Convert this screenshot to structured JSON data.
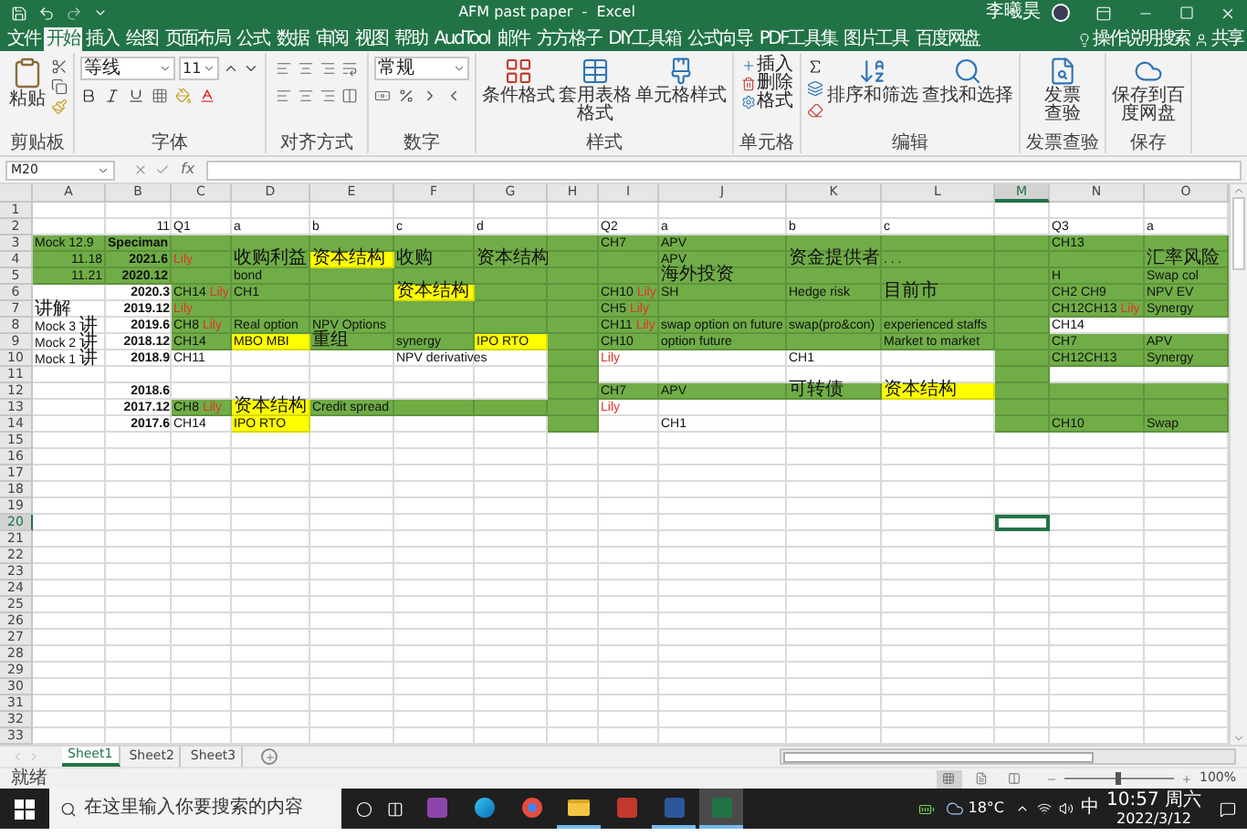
{
  "window": {
    "title": "AFM past paper  -  Excel",
    "user": "李曦昊"
  },
  "tabs": [
    {
      "label": "文件",
      "selected": false
    },
    {
      "label": "开始",
      "selected": true
    },
    {
      "label": "插入",
      "selected": false
    },
    {
      "label": "绘图",
      "selected": false
    },
    {
      "label": "页面布局",
      "selected": false
    },
    {
      "label": "公式",
      "selected": false
    },
    {
      "label": "数据",
      "selected": false
    },
    {
      "label": "审阅",
      "selected": false
    },
    {
      "label": "视图",
      "selected": false
    },
    {
      "label": "帮助",
      "selected": false
    },
    {
      "label": "AudTool",
      "selected": false
    },
    {
      "label": "邮件",
      "selected": false
    },
    {
      "label": "方方格子",
      "selected": false
    },
    {
      "label": "DIY工具箱",
      "selected": false
    },
    {
      "label": "公式向导",
      "selected": false
    },
    {
      "label": "PDF工具集",
      "selected": false
    },
    {
      "label": "图片工具",
      "selected": false
    },
    {
      "label": "百度网盘",
      "selected": false
    }
  ],
  "tell_me": "操作说明搜索",
  "share": "共享",
  "ribbon": [
    {
      "kind": "clipboard",
      "label": "剪贴板",
      "button": "粘贴"
    },
    {
      "kind": "font",
      "label": "字体",
      "font_name": "等线",
      "font_size": "11"
    },
    {
      "kind": "alignment",
      "label": "对齐方式"
    },
    {
      "kind": "number",
      "label": "数字",
      "format": "常规"
    },
    {
      "kind": "styles",
      "label": "样式",
      "buttons": [
        "条件格式",
        "套用表格格式",
        "单元格样式"
      ]
    },
    {
      "kind": "cells",
      "label": "单元格",
      "buttons": [
        "插入",
        "删除",
        "格式"
      ]
    },
    {
      "kind": "editing",
      "label": "编辑",
      "buttons": [
        "排序和筛选",
        "查找和选择"
      ]
    },
    {
      "kind": "invoice",
      "label": "发票查验",
      "button": "发票查验"
    },
    {
      "kind": "save",
      "label": "保存",
      "button": "保存到百度网盘"
    }
  ],
  "formula_bar": {
    "name_box": "M20",
    "fx": "fx"
  },
  "columns": [
    {
      "label": "A",
      "selected": false
    },
    {
      "label": "B",
      "selected": false
    },
    {
      "label": "C",
      "selected": false
    },
    {
      "label": "D",
      "selected": false
    },
    {
      "label": "E",
      "selected": false
    },
    {
      "label": "F",
      "selected": false
    },
    {
      "label": "G",
      "selected": false
    },
    {
      "label": "H",
      "selected": false
    },
    {
      "label": "I",
      "selected": false
    },
    {
      "label": "J",
      "selected": false
    },
    {
      "label": "K",
      "selected": false
    },
    {
      "label": "L",
      "selected": false
    },
    {
      "label": "M",
      "selected": true
    },
    {
      "label": "N",
      "selected": false
    },
    {
      "label": "O",
      "selected": false
    }
  ],
  "rows": [
    {
      "header": "1",
      "selected": false
    },
    {
      "header": "2",
      "selected": false,
      "cells": [
        {},
        {
          "text": "11"
        },
        {
          "text": "Q1"
        },
        {
          "text": "a"
        },
        {
          "text": "b"
        },
        {
          "text": "c"
        },
        {
          "text": "d"
        },
        {},
        {
          "text": "Q2"
        },
        {
          "text": "a"
        },
        {
          "text": "b"
        },
        {
          "text": "c"
        },
        {},
        {
          "text": "Q3"
        },
        {
          "text": "a"
        }
      ]
    },
    {
      "header": "3",
      "selected": false,
      "cells": [
        {
          "color": "#70ad47",
          "text": "Mock 12.9"
        },
        {
          "color": "#70ad47",
          "text": "Speciman",
          "bold": true
        },
        {
          "color": "#70ad47"
        },
        {
          "color": "#70ad47"
        },
        {
          "color": "#70ad47"
        },
        {
          "color": "#70ad47"
        },
        {
          "color": "#70ad47"
        },
        {
          "color": "#70ad47"
        },
        {
          "color": "#70ad47",
          "text": "CH7"
        },
        {
          "color": "#70ad47",
          "text": "APV"
        },
        {
          "color": "#70ad47"
        },
        {
          "color": "#70ad47"
        },
        {
          "color": "#70ad47"
        },
        {
          "color": "#70ad47",
          "text": "CH13"
        },
        {
          "color": "#70ad47"
        }
      ]
    },
    {
      "header": "4",
      "selected": false,
      "cells": [
        {
          "color": "#70ad47",
          "text": "11.18"
        },
        {
          "color": "#70ad47",
          "text": "2021.6",
          "bold": true
        },
        {
          "color": "#70ad47",
          "flag": "Lily"
        },
        {
          "color": "#70ad47",
          "text": "收购利益"
        },
        {
          "color": "#ffff00",
          "text": "资本结构"
        },
        {
          "color": "#70ad47",
          "text": "收购"
        },
        {
          "color": "#70ad47",
          "text": "资本结构"
        },
        {
          "color": "#70ad47"
        },
        {
          "color": "#70ad47"
        },
        {
          "color": "#70ad47",
          "text": "APV"
        },
        {
          "color": "#70ad47",
          "text": "资金提供者"
        },
        {
          "color": "#70ad47",
          "text": ". . ."
        },
        {
          "color": "#70ad47"
        },
        {
          "color": "#70ad47"
        },
        {
          "color": "#70ad47",
          "text": "汇率风险"
        }
      ]
    },
    {
      "header": "5",
      "selected": false,
      "cells": [
        {
          "color": "#70ad47",
          "text": "11.21"
        },
        {
          "color": "#70ad47",
          "text": "2020.12",
          "bold": true
        },
        {
          "color": "#70ad47"
        },
        {
          "color": "#70ad47",
          "text": "bond"
        },
        {
          "color": "#70ad47"
        },
        {
          "color": "#70ad47"
        },
        {
          "color": "#70ad47"
        },
        {
          "color": "#70ad47"
        },
        {
          "color": "#70ad47"
        },
        {
          "color": "#70ad47",
          "text": "海外投资"
        },
        {
          "color": "#70ad47"
        },
        {
          "color": "#70ad47"
        },
        {
          "color": "#70ad47"
        },
        {
          "color": "#70ad47",
          "text": "H"
        },
        {
          "color": "#70ad47",
          "text": "Swap col"
        }
      ]
    },
    {
      "header": "6",
      "selected": false,
      "cells": [
        {},
        {
          "text": "2020.3",
          "bold": true
        },
        {
          "color": "#70ad47",
          "text": "CH14",
          "flag": "Lily"
        },
        {
          "color": "#70ad47",
          "text": "CH1"
        },
        {
          "color": "#70ad47"
        },
        {
          "color": "#ffff00",
          "text": "资本结构"
        },
        {
          "color": "#70ad47"
        },
        {
          "color": "#70ad47"
        },
        {
          "color": "#70ad47",
          "text": "CH10",
          "flag": "Lily"
        },
        {
          "color": "#70ad47",
          "text": "SH"
        },
        {
          "color": "#70ad47",
          "text": "Hedge risk"
        },
        {
          "color": "#70ad47",
          "text": "目前市"
        },
        {
          "color": "#70ad47"
        },
        {
          "color": "#70ad47",
          "text": "CH2 CH9"
        },
        {
          "color": "#70ad47",
          "text": "NPV EV"
        }
      ]
    },
    {
      "header": "7",
      "selected": false,
      "cells": [
        {
          "text": "讲解"
        },
        {
          "text": "2019.12",
          "bold": true
        },
        {
          "color": "#70ad47",
          "flag": "Lily"
        },
        {
          "color": "#70ad47"
        },
        {
          "color": "#70ad47"
        },
        {
          "color": "#70ad47"
        },
        {
          "color": "#70ad47"
        },
        {
          "color": "#70ad47"
        },
        {
          "color": "#70ad47",
          "text": "CH5",
          "flag": "Lily"
        },
        {
          "color": "#70ad47"
        },
        {
          "color": "#70ad47"
        },
        {
          "color": "#70ad47"
        },
        {
          "color": "#70ad47"
        },
        {
          "color": "#70ad47",
          "text": "CH12CH13",
          "flag": "Lily"
        },
        {
          "color": "#70ad47",
          "text": "Synergy"
        }
      ]
    },
    {
      "header": "8",
      "selected": false,
      "cells": [
        {
          "text": "Mock 3 讲"
        },
        {
          "text": "2019.6",
          "bold": true
        },
        {
          "color": "#70ad47",
          "text": "CH8",
          "flag": "Lily"
        },
        {
          "color": "#70ad47",
          "text": "Real option"
        },
        {
          "color": "#70ad47",
          "text": "NPV Options"
        },
        {
          "color": "#70ad47"
        },
        {
          "color": "#70ad47"
        },
        {
          "color": "#70ad47"
        },
        {
          "color": "#70ad47",
          "text": "CH11",
          "flag": "Lily"
        },
        {
          "color": "#70ad47",
          "text": "swap option on future"
        },
        {
          "color": "#70ad47",
          "text": "swap(pro&con)"
        },
        {
          "color": "#70ad47",
          "text": "experienced staffs"
        },
        {
          "color": "#70ad47"
        },
        {
          "text": "CH14"
        },
        {}
      ]
    },
    {
      "header": "9",
      "selected": false,
      "cells": [
        {
          "text": "Mock 2 讲"
        },
        {
          "text": "2018.12",
          "bold": true
        },
        {
          "color": "#70ad47",
          "text": "CH14"
        },
        {
          "color": "#ffff00",
          "text": "MBO MBI"
        },
        {
          "color": "#70ad47",
          "text": "重组"
        },
        {
          "color": "#70ad47",
          "text": "synergy"
        },
        {
          "color": "#ffff00",
          "text": "IPO RTO"
        },
        {
          "color": "#70ad47"
        },
        {
          "color": "#70ad47",
          "text": "CH10"
        },
        {
          "color": "#70ad47",
          "text": "option future"
        },
        {
          "color": "#70ad47"
        },
        {
          "color": "#70ad47",
          "text": "Market to market"
        },
        {
          "color": "#70ad47"
        },
        {
          "color": "#70ad47",
          "text": "CH7"
        },
        {
          "color": "#70ad47",
          "text": "APV"
        }
      ]
    },
    {
      "header": "10",
      "selected": false,
      "cells": [
        {
          "text": "Mock 1 讲"
        },
        {
          "text": "2018.9",
          "bold": true
        },
        {
          "text": "CH11"
        },
        {},
        {},
        {
          "text": "NPV derivatives"
        },
        {},
        {
          "color": "#70ad47"
        },
        {
          "flag": "Lily"
        },
        {},
        {
          "text": "CH1"
        },
        {},
        {
          "color": "#70ad47"
        },
        {
          "color": "#70ad47",
          "text": "CH12CH13"
        },
        {
          "color": "#70ad47",
          "text": "Synergy"
        }
      ]
    },
    {
      "header": "11",
      "selected": false,
      "cells": [
        {},
        {},
        {},
        {},
        {},
        {},
        {},
        {
          "color": "#70ad47"
        },
        {},
        {},
        {},
        {},
        {
          "color": "#70ad47"
        },
        {},
        {}
      ]
    },
    {
      "header": "12",
      "selected": false,
      "cells": [
        {},
        {
          "text": "2018.6",
          "bold": true
        },
        {},
        {},
        {},
        {},
        {},
        {
          "color": "#70ad47"
        },
        {
          "color": "#70ad47",
          "text": "CH7"
        },
        {
          "color": "#70ad47",
          "text": "APV"
        },
        {
          "color": "#70ad47",
          "text": "可转债"
        },
        {
          "color": "#ffff00",
          "text": "资本结构"
        },
        {
          "color": "#70ad47"
        },
        {
          "color": "#70ad47"
        },
        {
          "color": "#70ad47"
        }
      ]
    },
    {
      "header": "13",
      "selected": false,
      "cells": [
        {},
        {
          "text": "2017.12",
          "bold": true
        },
        {
          "color": "#70ad47",
          "text": "CH8",
          "flag": "Lily"
        },
        {
          "color": "#ffff00",
          "text": "资本结构"
        },
        {
          "color": "#70ad47",
          "text": "Credit spread"
        },
        {
          "color": "#70ad47"
        },
        {
          "color": "#70ad47"
        },
        {
          "color": "#70ad47"
        },
        {
          "flag": "Lily"
        },
        {},
        {},
        {},
        {
          "color": "#70ad47"
        },
        {
          "color": "#70ad47"
        },
        {
          "color": "#70ad47"
        }
      ]
    },
    {
      "header": "14",
      "selected": false,
      "cells": [
        {},
        {
          "text": "2017.6",
          "bold": true
        },
        {
          "text": "CH14"
        },
        {
          "color": "#ffff00",
          "text": "IPO RTO"
        },
        {},
        {},
        {},
        {
          "color": "#70ad47"
        },
        {},
        {
          "text": "CH1"
        },
        {},
        {},
        {
          "color": "#70ad47"
        },
        {
          "color": "#70ad47",
          "text": "CH10"
        },
        {
          "color": "#70ad47",
          "text": "Swap"
        }
      ]
    },
    {
      "header": "15",
      "selected": false
    },
    {
      "header": "16",
      "selected": false
    },
    {
      "header": "17",
      "selected": false
    },
    {
      "header": "18",
      "selected": false
    },
    {
      "header": "19",
      "selected": false
    },
    {
      "header": "20",
      "selected": true
    },
    {
      "header": "21",
      "selected": false
    },
    {
      "header": "22",
      "selected": false
    },
    {
      "header": "23",
      "selected": false
    },
    {
      "header": "24",
      "selected": false
    },
    {
      "header": "25",
      "selected": false
    },
    {
      "header": "26",
      "selected": false
    },
    {
      "header": "27",
      "selected": false
    },
    {
      "header": "28",
      "selected": false
    },
    {
      "header": "29",
      "selected": false
    },
    {
      "header": "30",
      "selected": false
    },
    {
      "header": "31",
      "selected": false
    },
    {
      "header": "32",
      "selected": false
    },
    {
      "header": "33",
      "selected": false
    }
  ],
  "sheets": [
    {
      "label": "Sheet1",
      "selected": true
    },
    {
      "label": "Sheet2",
      "selected": false
    },
    {
      "label": "Sheet3",
      "selected": false
    }
  ],
  "status_bar": {
    "text": "就绪",
    "views": [
      {
        "selected": true
      },
      {
        "selected": false
      },
      {
        "selected": false
      }
    ],
    "zoom_slider": {
      "level": 0.5
    },
    "zoom": "100%"
  },
  "taskbar": {
    "search_placeholder": "在这里输入你要搜索的内容",
    "apps": [
      {
        "kind": "notes",
        "running": false,
        "selected": false
      },
      {
        "kind": "edge",
        "running": false,
        "selected": false
      },
      {
        "kind": "chrome",
        "running": false,
        "selected": false
      },
      {
        "kind": "folder",
        "running": true,
        "selected": false
      },
      {
        "kind": "pdf",
        "running": false,
        "selected": false
      },
      {
        "kind": "word",
        "running": true,
        "selected": false
      },
      {
        "kind": "excel",
        "running": true,
        "selected": true
      }
    ],
    "temperature": "18°C",
    "ime": "中",
    "time": "10:57 周六",
    "date": "2022/3/12"
  }
}
